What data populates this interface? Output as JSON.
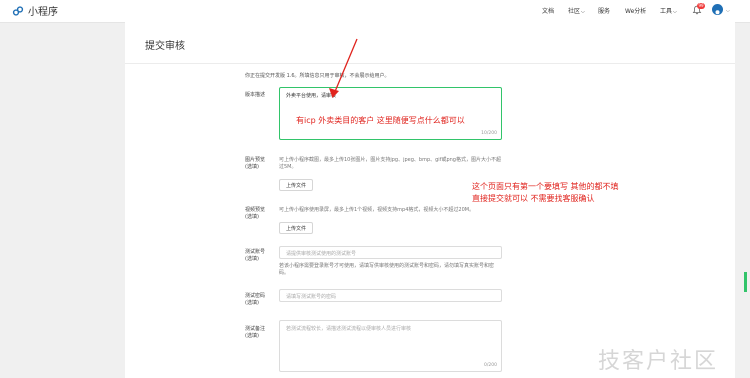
{
  "app": {
    "title": "小程序"
  },
  "nav": {
    "docs": "文档",
    "community": "社区",
    "service": "服务",
    "analytics": "We分析",
    "tools": "工具",
    "notif_count": "99"
  },
  "page": {
    "title": "提交审核"
  },
  "version_note": "你正在提交开发版 1.6。所填信息只用于审核，不会展示给用户。",
  "fields": {
    "version_desc": {
      "label": "版本描述",
      "value": "外卖平台使用，请审核",
      "counter": "10/200"
    },
    "image_preview": {
      "label_1": "图片预览",
      "label_2": "(选填)",
      "help_1": "可上传小程序截图，最多上传10张图片，图片支持jpg、jpeg、bmp、gif或png格式，图片大小不超",
      "help_2": "过5M。",
      "button": "上传文件"
    },
    "video_preview": {
      "label_1": "视频预览",
      "label_2": "(选填)",
      "help": "可上传小程序使用录屏，最多上传1个视频，视频支持mp4格式，视频大小不超过20M。",
      "button": "上传文件"
    },
    "test_account": {
      "label_1": "测试账号",
      "label_2": "(选填)",
      "placeholder": "请提供审核测试使用的测试账号",
      "help_1": "若该小程序需要登录账号才可使用，请填写供审核使用的测试账号和密码，请勿填写真实账号和密",
      "help_2": "码。"
    },
    "test_password": {
      "label_1": "测试密码",
      "label_2": "(选填)",
      "placeholder": "请填写测试账号的密码"
    },
    "test_notes": {
      "label_1": "测试备注",
      "label_2": "(选填)",
      "placeholder": "若测试流程较长，请描述测试流程以便审核人员进行审核",
      "counter": "0/200"
    }
  },
  "annotations": {
    "box_note": "有icp 外卖类目的客户 这里随便写点什么都可以",
    "side_note_1": "这个页面只有第一个要填写  其他的都不填",
    "side_note_2": "直接提交就可以 不需要找客服确认",
    "color": "#e0231d"
  },
  "watermark": "技客户社区"
}
